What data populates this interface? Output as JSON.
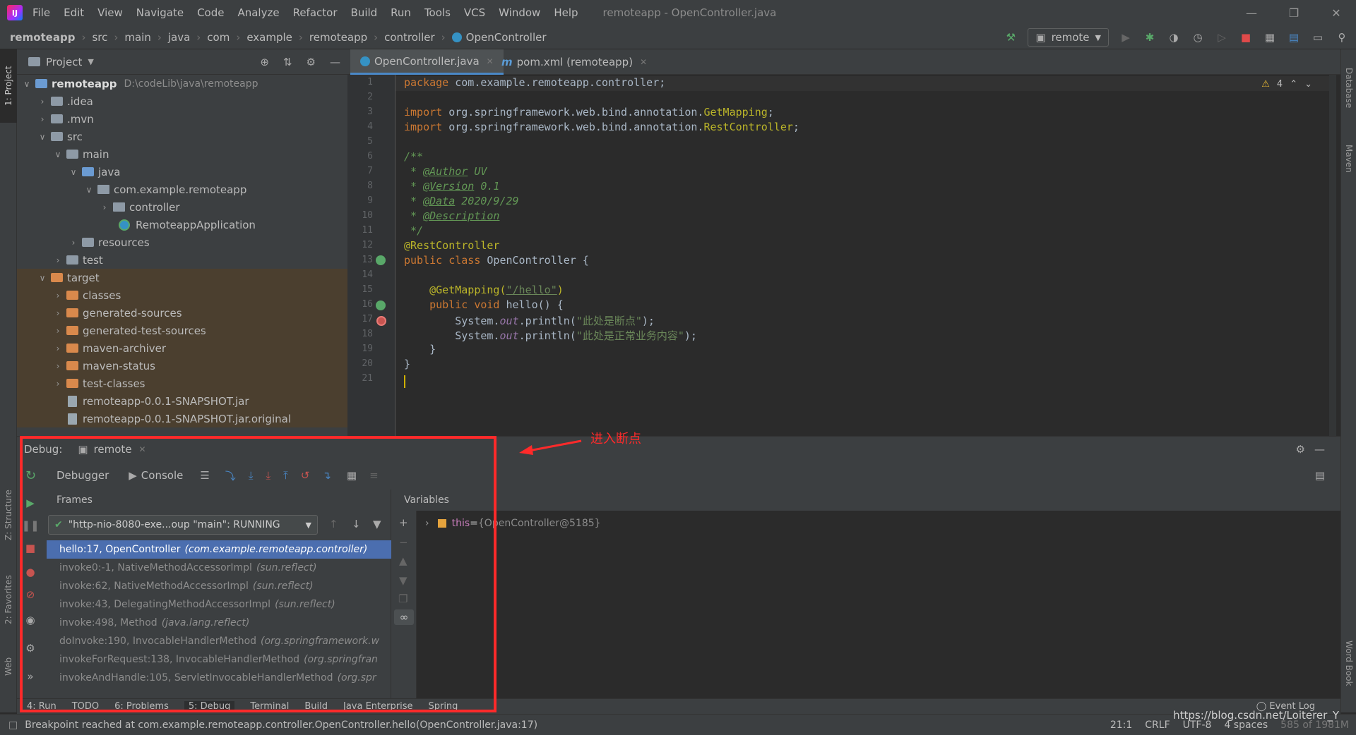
{
  "menubar": {
    "items": [
      "File",
      "Edit",
      "View",
      "Navigate",
      "Code",
      "Analyze",
      "Refactor",
      "Build",
      "Run",
      "Tools",
      "VCS",
      "Window",
      "Help"
    ],
    "window_title": "remoteapp - OpenController.java"
  },
  "navbar": {
    "breadcrumb": [
      "remoteapp",
      "src",
      "main",
      "java",
      "com",
      "example",
      "remoteapp",
      "controller",
      "OpenController"
    ],
    "run_config": "remote"
  },
  "leftstrip": {
    "project_tab": "1: Project",
    "structure_tab": "Z: Structure",
    "favorites_tab": "2: Favorites",
    "web_tab": "Web"
  },
  "rightstrip": {
    "database_tab": "Database",
    "maven_tab": "Maven",
    "wordbook_tab": "Word Book"
  },
  "project": {
    "title": "Project",
    "tree": [
      {
        "label": "remoteapp",
        "path": "D:\\codeLib\\java\\remoteapp"
      },
      {
        "label": ".idea"
      },
      {
        "label": ".mvn"
      },
      {
        "label": "src"
      },
      {
        "label": "main"
      },
      {
        "label": "java"
      },
      {
        "label": "com.example.remoteapp"
      },
      {
        "label": "controller"
      },
      {
        "label": "RemoteappApplication"
      },
      {
        "label": "resources"
      },
      {
        "label": "test"
      },
      {
        "label": "target"
      },
      {
        "label": "classes"
      },
      {
        "label": "generated-sources"
      },
      {
        "label": "generated-test-sources"
      },
      {
        "label": "maven-archiver"
      },
      {
        "label": "maven-status"
      },
      {
        "label": "test-classes"
      },
      {
        "label": "remoteapp-0.0.1-SNAPSHOT.jar"
      },
      {
        "label": "remoteapp-0.0.1-SNAPSHOT.jar.original"
      }
    ]
  },
  "editor": {
    "tabs": [
      {
        "label": "OpenController.java"
      },
      {
        "label": "pom.xml (remoteapp)"
      }
    ],
    "warnings": "4",
    "line_numbers": [
      "1",
      "2",
      "3",
      "4",
      "5",
      "6",
      "7",
      "8",
      "9",
      "10",
      "11",
      "12",
      "13",
      "14",
      "15",
      "16",
      "17",
      "18",
      "19",
      "20",
      "21"
    ],
    "code": {
      "l1_kw": "package",
      "l1_rest": " com.example.remoteapp.controller;",
      "l3_kw": "import",
      "l3_rest": " org.springframework.web.bind.annotation.",
      "l3_cls": "GetMapping",
      "l3_end": ";",
      "l4_kw": "import",
      "l4_rest": " org.springframework.web.bind.annotation.",
      "l4_cls": "RestController",
      "l4_end": ";",
      "l6": "/**",
      "l7_star": " * ",
      "l7_tag": "@Author",
      "l7_val": " UV",
      "l8_star": " * ",
      "l8_tag": "@Version",
      "l8_val": " 0.1",
      "l9_star": " * ",
      "l9_tag": "@Data",
      "l9_val": " 2020/9/29",
      "l10_star": " * ",
      "l10_tag": "@Description",
      "l11": " */",
      "l12": "@RestController",
      "l13_kw": "public class",
      "l13_rest": " OpenController {",
      "l15_pad": "    ",
      "l15_ann": "@GetMapping(",
      "l15_str": "\"/hello\"",
      "l15_end": ")",
      "l16_pad": "    ",
      "l16_kw": "public void",
      "l16_rest": " hello() {",
      "l17_a": "        System.",
      "l17_f": "out",
      "l17_b": ".println(",
      "l17_s": "\"此处是断点\"",
      "l17_e": ");",
      "l18_a": "        System.",
      "l18_f": "out",
      "l18_b": ".println(",
      "l18_s": "\"此处是正常业务内容\"",
      "l18_e": ");",
      "l19": "    }",
      "l20": "}"
    }
  },
  "debug": {
    "label": "Debug:",
    "session_tab": "remote",
    "tabs": {
      "debugger": "Debugger",
      "console": "Console"
    },
    "frames_header": "Frames",
    "thread": "\"http-nio-8080-exe...oup \"main\": RUNNING",
    "frames": [
      {
        "method": "hello:17, OpenController",
        "pkg": "(com.example.remoteapp.controller)"
      },
      {
        "method": "invoke0:-1, NativeMethodAccessorImpl",
        "pkg": "(sun.reflect)"
      },
      {
        "method": "invoke:62, NativeMethodAccessorImpl",
        "pkg": "(sun.reflect)"
      },
      {
        "method": "invoke:43, DelegatingMethodAccessorImpl",
        "pkg": "(sun.reflect)"
      },
      {
        "method": "invoke:498, Method",
        "pkg": "(java.lang.reflect)"
      },
      {
        "method": "doInvoke:190, InvocableHandlerMethod",
        "pkg": "(org.springframework.w"
      },
      {
        "method": "invokeForRequest:138, InvocableHandlerMethod",
        "pkg": "(org.springfran"
      },
      {
        "method": "invokeAndHandle:105, ServletInvocableHandlerMethod",
        "pkg": "(org.spr"
      }
    ],
    "variables_header": "Variables",
    "variable": {
      "name": "this",
      "eq": " = ",
      "value": "{OpenController@5185}"
    }
  },
  "bottom_tabs": [
    "4: Run",
    "TODO",
    "6: Problems",
    "5: Debug",
    "Terminal",
    "Build",
    "Java Enterprise",
    "Spring"
  ],
  "event_log": "Event Log",
  "status": {
    "message": "Breakpoint reached at com.example.remoteapp.controller.OpenController.hello(OpenController.java:17)",
    "position": "21:1",
    "line_sep": "CRLF",
    "encoding": "UTF-8",
    "indent": "4 spaces",
    "memory": "585 of 1981M",
    "watermark": "https://blog.csdn.net/Loiterer_Y"
  },
  "annotation": {
    "text": "进入断点",
    "color": "#ff2a2a"
  }
}
